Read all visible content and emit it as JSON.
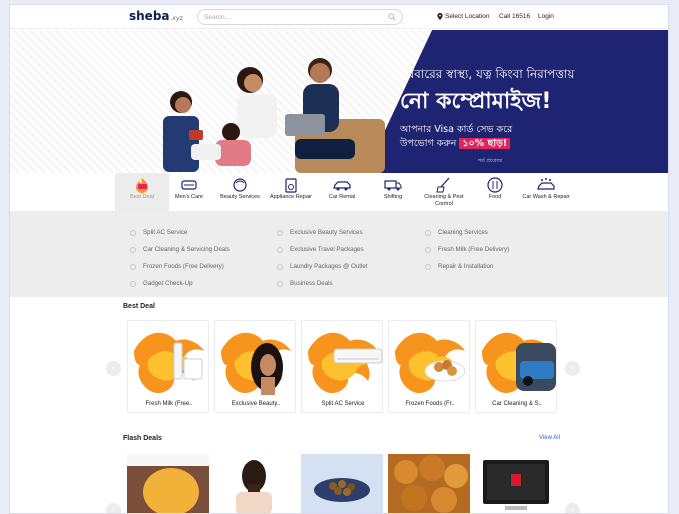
{
  "header": {
    "logo": "sheba",
    "logo_tag": ".xyz",
    "search_placeholder": "Search...",
    "select_location": "Select Location",
    "call": "Call 16516",
    "login": "Login"
  },
  "banner": {
    "line1": "পরিবারের স্বাস্থ্য, যত্ন কিংবা নিরাপত্তায়",
    "line2": "নো কম্প্রোমাইজ!",
    "line3": "আপনার Visa কার্ড সেভ করে",
    "line4_prefix": "উপভোগ করুন",
    "line4_highlight": "১০% ছাড়!",
    "terms": "শর্ত প্রযোজ্য"
  },
  "categories": [
    {
      "label": "Best Deal",
      "icon": "best-deal-icon",
      "active": true
    },
    {
      "label": "Men's Care",
      "icon": "mens-care-icon"
    },
    {
      "label": "Beauty Services",
      "icon": "beauty-icon"
    },
    {
      "label": "Appliance Repair",
      "icon": "appliance-icon"
    },
    {
      "label": "Car Rental",
      "icon": "car-icon"
    },
    {
      "label": "Shifting",
      "icon": "truck-icon"
    },
    {
      "label": "Cleaning & Pest Control",
      "icon": "cleaning-icon"
    },
    {
      "label": "Food",
      "icon": "food-icon"
    },
    {
      "label": "Car Wash & Repair",
      "icon": "car-wash-icon"
    }
  ],
  "offers": [
    [
      "Split AC Service",
      "Exclusive Beauty Services",
      "Cleaning Services"
    ],
    [
      "Car Cleaning & Servicing Deals",
      "Exclusive Travel Packages",
      "Fresh Milk (Free Delivery)"
    ],
    [
      "Frozen Foods (Free Delivery)",
      "Laundry Packages @ Outlet",
      "Repair & Installation"
    ],
    [
      "Gadget Check-Up",
      "Business Deals",
      ""
    ]
  ],
  "best_deal": {
    "title": "Best Deal",
    "items": [
      "Fresh Milk (Free..",
      "Exclusive Beauty..",
      "Split AC Service",
      "Frozen Foods (Fr..",
      "Car Cleaning & S.."
    ]
  },
  "flash_deals": {
    "title": "Flash Deals",
    "view_all": "View All"
  },
  "colors": {
    "brand_navy": "#1f2472",
    "highlight_pink": "#e0245e",
    "flame_orange": "#f7941d",
    "link_blue": "#2f5fd0"
  }
}
